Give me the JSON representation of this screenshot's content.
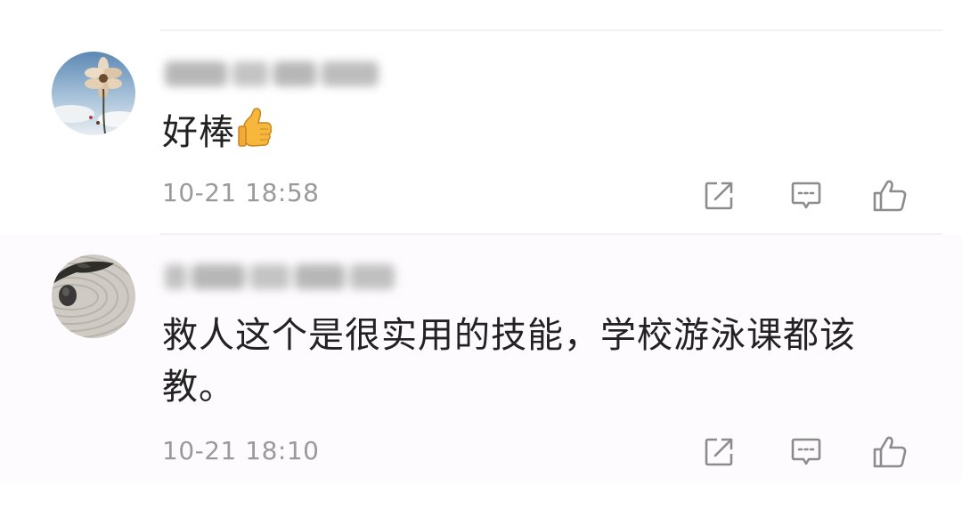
{
  "comments": [
    {
      "username": "",
      "text": "好棒",
      "emoji": "thumbs-up-emoji",
      "timestamp": "10-21 18:58",
      "avatar": "flower-sky-avatar",
      "actions": [
        "share-icon",
        "reply-icon",
        "like-icon"
      ]
    },
    {
      "username": "",
      "text": "救人这个是很实用的技能，学校游泳课都该教。",
      "timestamp": "10-21 18:10",
      "avatar": "zen-garden-avatar",
      "actions": [
        "share-icon",
        "reply-icon",
        "like-icon"
      ]
    }
  ],
  "colors": {
    "text": "#222222",
    "meta": "#9a9a9a",
    "icon": "#8c8c8c",
    "divider": "#f1f1f1"
  }
}
